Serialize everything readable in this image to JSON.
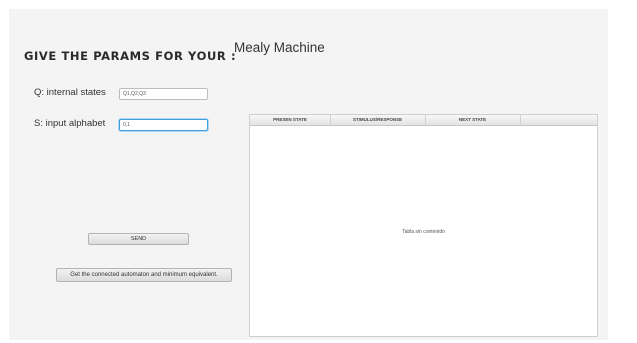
{
  "form": {
    "heading": "GIVE THE PARAMS FOR YOUR :",
    "machine_type": "Mealy Machine",
    "states_label": "Q: internal states",
    "states_value": "Q1,Q2,Q3",
    "alphabet_label": "S: input alphabet",
    "alphabet_value": "0,1",
    "send_label": "SEND",
    "automaton_label": "Get the connected automaton and minimum equivalent."
  },
  "table": {
    "columns": [
      "PRESEN STATE",
      "STIMULUS/RESPONSE",
      "NEXT STATE",
      ""
    ],
    "empty_message": "Tabla sin contenido"
  },
  "colors": {
    "focus": "#3c9fe0",
    "panel": "#f4f4f4"
  }
}
